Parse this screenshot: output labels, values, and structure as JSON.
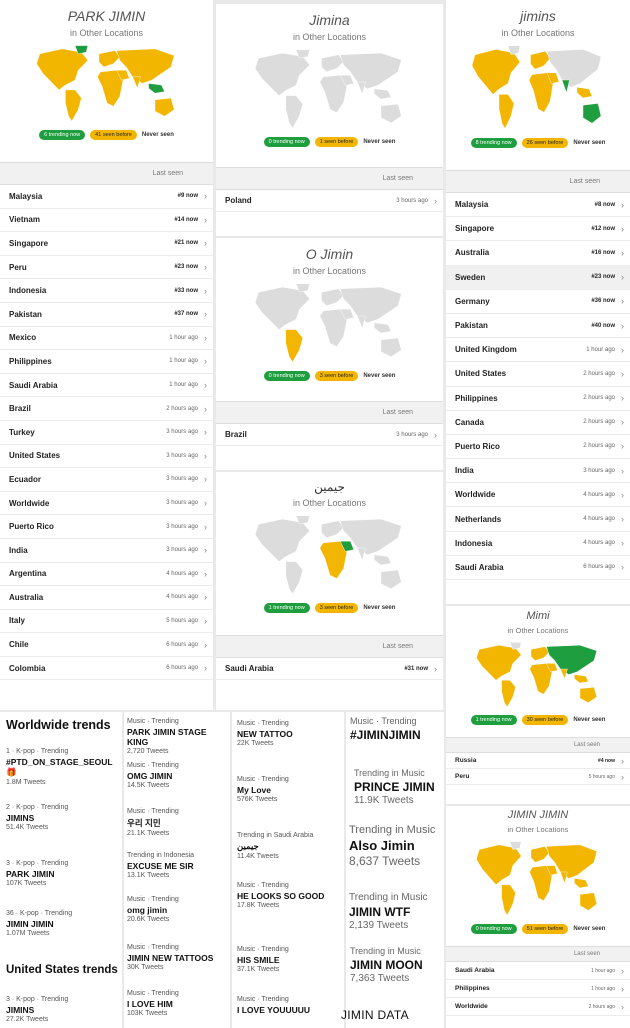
{
  "colors": {
    "green": "#1e9e3e",
    "yellow": "#f2b600",
    "land": "#dcdcdc"
  },
  "legend": {
    "never": "Never seen"
  },
  "last_seen": "Last seen",
  "chevron_icon": "chevron-right-icon",
  "panel1": {
    "title": "PARK JIMIN",
    "subtitle": "in Other Locations",
    "trending": "6 trending now",
    "seen": "41 seen before",
    "rows": [
      {
        "country": "Malaysia",
        "status": "#9 now"
      },
      {
        "country": "Vietnam",
        "status": "#14 now"
      },
      {
        "country": "Singapore",
        "status": "#21 now"
      },
      {
        "country": "Peru",
        "status": "#23 now"
      },
      {
        "country": "Indonesia",
        "status": "#33 now"
      },
      {
        "country": "Pakistan",
        "status": "#37 now"
      },
      {
        "country": "Mexico",
        "status": "1 hour ago"
      },
      {
        "country": "Philippines",
        "status": "1 hour ago"
      },
      {
        "country": "Saudi Arabia",
        "status": "1 hour ago"
      },
      {
        "country": "Brazil",
        "status": "2 hours ago"
      },
      {
        "country": "Turkey",
        "status": "3 hours ago"
      },
      {
        "country": "United States",
        "status": "3 hours ago"
      },
      {
        "country": "Ecuador",
        "status": "3 hours ago"
      },
      {
        "country": "Worldwide",
        "status": "3 hours ago"
      },
      {
        "country": "Puerto Rico",
        "status": "3 hours ago"
      },
      {
        "country": "India",
        "status": "3 hours ago"
      },
      {
        "country": "Argentina",
        "status": "4 hours ago"
      },
      {
        "country": "Australia",
        "status": "4 hours ago"
      },
      {
        "country": "Italy",
        "status": "5 hours ago"
      },
      {
        "country": "Chile",
        "status": "6 hours ago"
      },
      {
        "country": "Colombia",
        "status": "6 hours ago"
      }
    ]
  },
  "panel2": {
    "title": "Jimina",
    "subtitle": "in Other Locations",
    "trending": "0 trending now",
    "seen": "1 seen before",
    "row": {
      "country": "Poland",
      "status": "3 hours ago"
    }
  },
  "panel3": {
    "title": "O Jimin",
    "subtitle": "in Other Locations",
    "trending": "0 trending now",
    "seen": "3 seen before",
    "row": {
      "country": "Brazil",
      "status": "3 hours ago"
    }
  },
  "panel4": {
    "title": "جيمين",
    "subtitle": "in Other Locations",
    "trending": "1 trending now",
    "seen": "3 seen before",
    "row": {
      "country": "Saudi Arabia",
      "status": "#31 now"
    }
  },
  "panel5": {
    "title": "jimins",
    "subtitle": "in Other Locations",
    "trending": "8 trending now",
    "seen": "26 seen before",
    "rows": [
      {
        "country": "Malaysia",
        "status": "#8 now"
      },
      {
        "country": "Singapore",
        "status": "#12 now"
      },
      {
        "country": "Australia",
        "status": "#16 now"
      },
      {
        "country": "Sweden",
        "status": "#23 now"
      },
      {
        "country": "Germany",
        "status": "#36 now"
      },
      {
        "country": "Pakistan",
        "status": "#40 now"
      },
      {
        "country": "United Kingdom",
        "status": "1 hour ago"
      },
      {
        "country": "United States",
        "status": "2 hours ago"
      },
      {
        "country": "Philippines",
        "status": "2 hours ago"
      },
      {
        "country": "Canada",
        "status": "2 hours ago"
      },
      {
        "country": "Puerto Rico",
        "status": "2 hours ago"
      },
      {
        "country": "India",
        "status": "3 hours ago"
      },
      {
        "country": "Worldwide",
        "status": "4 hours ago"
      },
      {
        "country": "Netherlands",
        "status": "4 hours ago"
      },
      {
        "country": "Indonesia",
        "status": "4 hours ago"
      },
      {
        "country": "Saudi Arabia",
        "status": "6 hours ago"
      }
    ]
  },
  "panel6": {
    "title": "Mimi",
    "subtitle": "in Other Locations",
    "trending": "1 trending now",
    "seen": "30 seen before",
    "rows": [
      {
        "country": "Russia",
        "status": "#4 now"
      },
      {
        "country": "Peru",
        "status": "5 hours ago"
      }
    ]
  },
  "panel7": {
    "title": "JIMIN JIMIN",
    "subtitle": "in Other Locations",
    "trending": "0 trending now",
    "seen": "51 seen before",
    "rows": [
      {
        "country": "Saudi Arabia",
        "status": "1 hour ago"
      },
      {
        "country": "Philippines",
        "status": "1 hour ago"
      },
      {
        "country": "Worldwide",
        "status": "2 hours ago"
      }
    ]
  },
  "trends": {
    "worldwide_heading": "Worldwide trends",
    "us_heading": "United States trends",
    "col1": [
      {
        "cat": "1 · K-pop · Trending",
        "name": "#PTD_ON_STAGE_SEOUL 🎁",
        "count": "1.8M Tweets"
      },
      {
        "cat": "2 · K-pop · Trending",
        "name": "JIMINS",
        "count": "51.4K Tweets"
      },
      {
        "cat": "3 · K-pop · Trending",
        "name": "PARK JIMIN",
        "count": "107K Tweets"
      },
      {
        "cat": "36 · K-pop · Trending",
        "name": "JIMIN JIMIN",
        "count": "1.07M Tweets"
      },
      {
        "cat": "3 · K-pop · Trending",
        "name": "JIMINS",
        "count": "27.2K Tweets"
      }
    ],
    "col2": [
      {
        "cat": "Music · Trending",
        "name": "PARK JIMIN STAGE KING",
        "count": "2,720 Tweets"
      },
      {
        "cat": "Music · Trending",
        "name": "OMG JIMIN",
        "count": "14.5K Tweets"
      },
      {
        "cat": "Music · Trending",
        "name": "우리 지민",
        "count": "21.1K Tweets"
      },
      {
        "cat": "Trending in Indonesia",
        "name": "EXCUSE ME SIR",
        "count": "13.1K Tweets"
      },
      {
        "cat": "Music · Trending",
        "name": "omg jimin",
        "count": "20.6K Tweets"
      },
      {
        "cat": "Music · Trending",
        "name": "JIMIN NEW TATTOOS",
        "count": "30K Tweets"
      },
      {
        "cat": "Music · Trending",
        "name": "I LOVE HIM",
        "count": "103K Tweets"
      }
    ],
    "col3": [
      {
        "cat": "Music · Trending",
        "name": "NEW TATTOO",
        "count": "22K Tweets"
      },
      {
        "cat": "Music · Trending",
        "name": "My Love",
        "count": "576K Tweets"
      },
      {
        "cat": "Trending in Saudi Arabia",
        "name": "جيمين",
        "count": "11.4K Tweets"
      },
      {
        "cat": "Music · Trending",
        "name": "HE LOOKS SO GOOD",
        "count": "17.8K Tweets"
      },
      {
        "cat": "Music · Trending",
        "name": "HIS SMILE",
        "count": "37.1K Tweets"
      },
      {
        "cat": "Music · Trending",
        "name": "I LOVE YOUUUUU",
        "count": ""
      }
    ],
    "col4": [
      {
        "cat": "Music · Trending",
        "name": "#JIMINJIMIN",
        "count": ""
      },
      {
        "cat": "Trending in Music",
        "name": "PRINCE JIMIN",
        "count": "11.9K Tweets"
      },
      {
        "cat": "Trending in Music",
        "name": "Also Jimin",
        "count": "8,637 Tweets"
      },
      {
        "cat": "Trending in Music",
        "name": "JIMIN WTF",
        "count": "2,139 Tweets"
      },
      {
        "cat": "Trending in Music",
        "name": "JIMIN MOON",
        "count": "7,363 Tweets"
      }
    ],
    "footer": "JIMIN DATA"
  }
}
